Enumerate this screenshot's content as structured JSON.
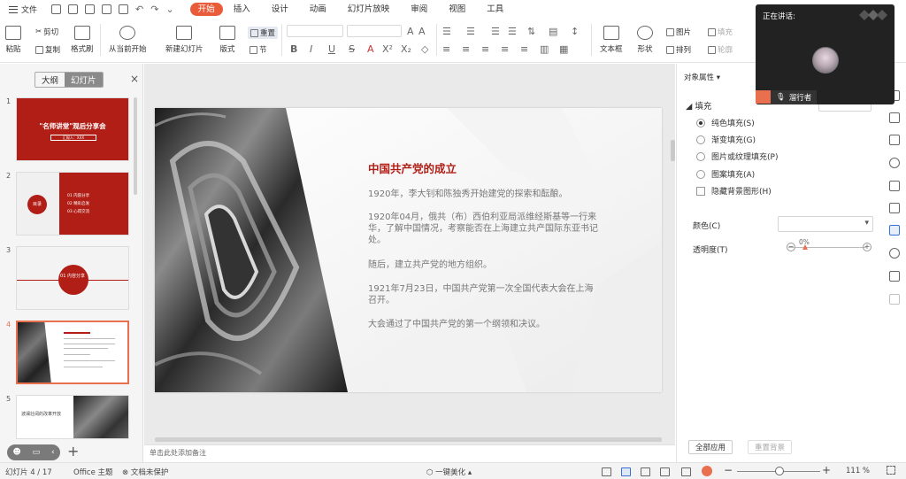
{
  "menubar": {
    "file_label": "文件",
    "tabs": [
      "开始",
      "插入",
      "设计",
      "动画",
      "幻灯片放映",
      "审阅",
      "视图",
      "工具"
    ],
    "active_tab": "开始"
  },
  "ribbon": {
    "paste": "粘贴",
    "cut": "剪切",
    "copy": "复制",
    "format_painter": "格式刷",
    "play_from_current": "从当前开始",
    "new_slide": "新建幻灯片",
    "layout": "版式",
    "reset": "重置",
    "section": "节",
    "textbox": "文本框",
    "shape": "形状",
    "picture": "图片",
    "arrange": "排列",
    "fill": "填充",
    "outline": "轮廓"
  },
  "left_panel": {
    "tab_outline": "大纲",
    "tab_slides": "幻灯片",
    "thumbnails": [
      {
        "num": "1",
        "title": "\"名师讲堂\"观后分享会",
        "subtitle": "汇报人：XXX"
      },
      {
        "num": "2",
        "label": "目录",
        "items": [
          "01 内容分享",
          "02 精彩启发",
          "03 心得交流"
        ]
      },
      {
        "num": "3",
        "label": "01 内容分享"
      },
      {
        "num": "4"
      },
      {
        "num": "5",
        "label": "波澜壮阔的改革开放"
      }
    ]
  },
  "slide": {
    "title": "中国共产党的成立",
    "paragraphs": [
      "1920年，李大钊和陈独秀开始建党的探索和酝酿。",
      "1920年04月，俄共（布）西伯利亚局派维经斯基等一行来华，了解中国情况，考察能否在上海建立共产国际东亚书记处。",
      "随后，建立共产党的地方组织。",
      "1921年7月23日，中国共产党第一次全国代表大会在上海召开。",
      "大会通过了中国共产党的第一个纲领和决议。"
    ]
  },
  "notes_placeholder": "单击此处添加备注",
  "right_panel": {
    "title": "对象属性",
    "section": "填充",
    "options": [
      "纯色填充(S)",
      "渐变填充(G)",
      "图片或纹理填充(P)",
      "图案填充(A)"
    ],
    "checkbox": "隐藏背景图形(H)",
    "color_label": "颜色(C)",
    "transparency_label": "透明度(T)",
    "transparency_value": "0%",
    "apply_all": "全部应用",
    "reset_bg": "重置背景"
  },
  "presenter": {
    "header": "正在讲话:",
    "name": "溜行者"
  },
  "statusbar": {
    "slide_info": "幻灯片 4 / 17",
    "theme": "Office 主题",
    "doc_status": "文档未保护",
    "beautify": "一键美化",
    "zoom": "111 %"
  }
}
